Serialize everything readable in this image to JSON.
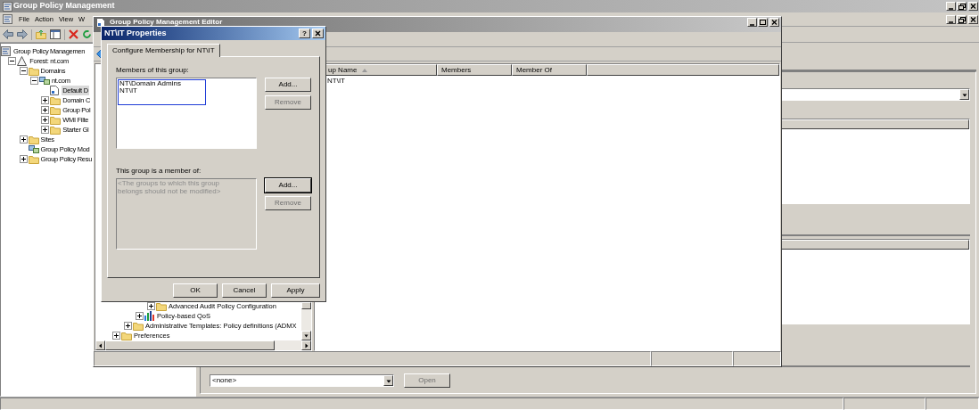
{
  "main_window": {
    "title": "Group Policy Management",
    "menu": [
      "File",
      "Action",
      "View",
      "W"
    ],
    "tree": [
      {
        "label": "Group Policy Managemen",
        "kind": "console",
        "selected": false,
        "children": [
          {
            "label": "Forest: nt.com",
            "kind": "forest",
            "expanded": true,
            "selected": false,
            "children": [
              {
                "label": "Domains",
                "kind": "folder",
                "expanded": true,
                "selected": false,
                "children": [
                  {
                    "label": "nt.com",
                    "kind": "domain",
                    "expanded": true,
                    "selected": false,
                    "children": [
                      {
                        "label": "Default D",
                        "kind": "gpo",
                        "selected": true
                      },
                      {
                        "label": "Domain C",
                        "kind": "folder",
                        "expanded": false,
                        "selected": false
                      },
                      {
                        "label": "Group Pol",
                        "kind": "folder",
                        "expanded": false,
                        "selected": false
                      },
                      {
                        "label": "WMI Filte",
                        "kind": "folder",
                        "expanded": false,
                        "selected": false
                      },
                      {
                        "label": "Starter Gl",
                        "kind": "folder",
                        "expanded": false,
                        "selected": false
                      }
                    ]
                  }
                ]
              },
              {
                "label": "Sites",
                "kind": "folder",
                "expanded": false,
                "selected": false
              },
              {
                "label": "Group Policy Mod",
                "kind": "domain",
                "selected": false
              },
              {
                "label": "Group Policy Resu",
                "kind": "folder",
                "expanded": false,
                "selected": false
              }
            ]
          }
        ]
      }
    ],
    "link_combo": {
      "value": "<none>"
    },
    "open_button": {
      "label": "Open",
      "disabled": true
    }
  },
  "editor_window": {
    "title": "Group Policy Management Editor",
    "tree": [
      {
        "children": [
          {
            "children": [
              {
                "children": [
                  {
                    "label": "Advanced Audit Policy Configuration",
                    "kind": "folder",
                    "expanded": false
                  }
                ]
              },
              {
                "label": "Policy-based QoS",
                "kind": "chart",
                "expanded": false
              }
            ]
          },
          {
            "label": "Administrative Templates: Policy definitions (ADMX",
            "kind": "folder",
            "expanded": false
          }
        ]
      },
      {
        "label": "Preferences",
        "kind": "folder",
        "expanded": false
      }
    ],
    "columns": [
      {
        "label": "up Name",
        "sorted": true
      },
      {
        "label": "Members",
        "sorted": false
      },
      {
        "label": "Member Of",
        "sorted": false
      }
    ],
    "rows": [
      [
        "NT\\IT"
      ]
    ]
  },
  "dialog": {
    "title": "NT\\IT Properties",
    "help": "?",
    "tabs": [
      {
        "label": "Configure Membership for NT\\IT",
        "selected": true
      }
    ],
    "members_label": "Members of this group:",
    "members": [
      "NT\\Domain Admins",
      "NT\\IT"
    ],
    "members_highlighted": true,
    "members_buttons": [
      {
        "label": "Add...",
        "disabled": false,
        "focused": false
      },
      {
        "label": "Remove",
        "disabled": true,
        "focused": false
      }
    ],
    "member_of_label": "This group is a member of:",
    "member_of_note": "<The groups to which this group belongs should not be modified>",
    "member_of_buttons": [
      {
        "label": "Add...",
        "disabled": false,
        "focused": true
      },
      {
        "label": "Remove",
        "disabled": true,
        "focused": false
      }
    ],
    "footer_buttons": [
      {
        "label": "OK"
      },
      {
        "label": "Cancel"
      },
      {
        "label": "Apply"
      }
    ]
  }
}
